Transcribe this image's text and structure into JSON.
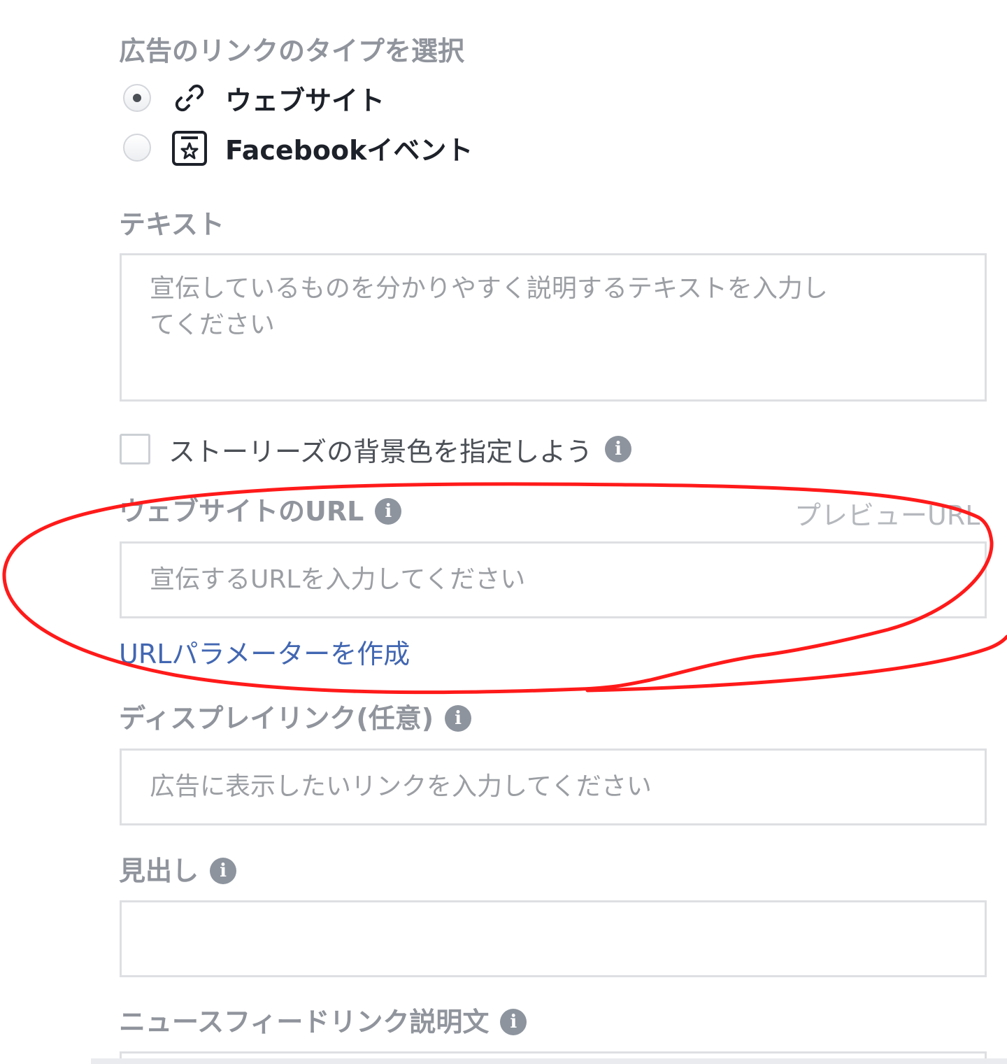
{
  "link_type": {
    "label": "広告のリンクのタイプを選択",
    "options": [
      {
        "label": "ウェブサイト",
        "icon": "link-icon",
        "selected": true
      },
      {
        "label": "Facebookイベント",
        "icon": "event-star-icon",
        "selected": false
      }
    ]
  },
  "text_field": {
    "label": "テキスト",
    "placeholder": "宣伝しているものを分かりやすく説明するテキストを入力し\nてください"
  },
  "stories_bg": {
    "label": "ストーリーズの背景色を指定しよう",
    "checked": false,
    "info_icon": "i"
  },
  "website_url": {
    "label": "ウェブサイトのURL",
    "info_icon": "i",
    "preview_link": "プレビューURL",
    "placeholder": "宣伝するURLを入力してください",
    "param_link": "URLパラメーターを作成"
  },
  "display_link": {
    "label": "ディスプレイリンク(任意)",
    "info_icon": "i",
    "placeholder": "広告に表示したいリンクを入力してください"
  },
  "headline": {
    "label": "見出し",
    "info_icon": "i",
    "placeholder": ""
  },
  "news_feed_desc": {
    "label": "ニュースフィードリンク説明文",
    "info_icon": "i"
  },
  "colors": {
    "annotation": "#ff1a1a",
    "link": "#4267b2",
    "label_gray": "#90949c",
    "info_icon": "#8d949e"
  }
}
